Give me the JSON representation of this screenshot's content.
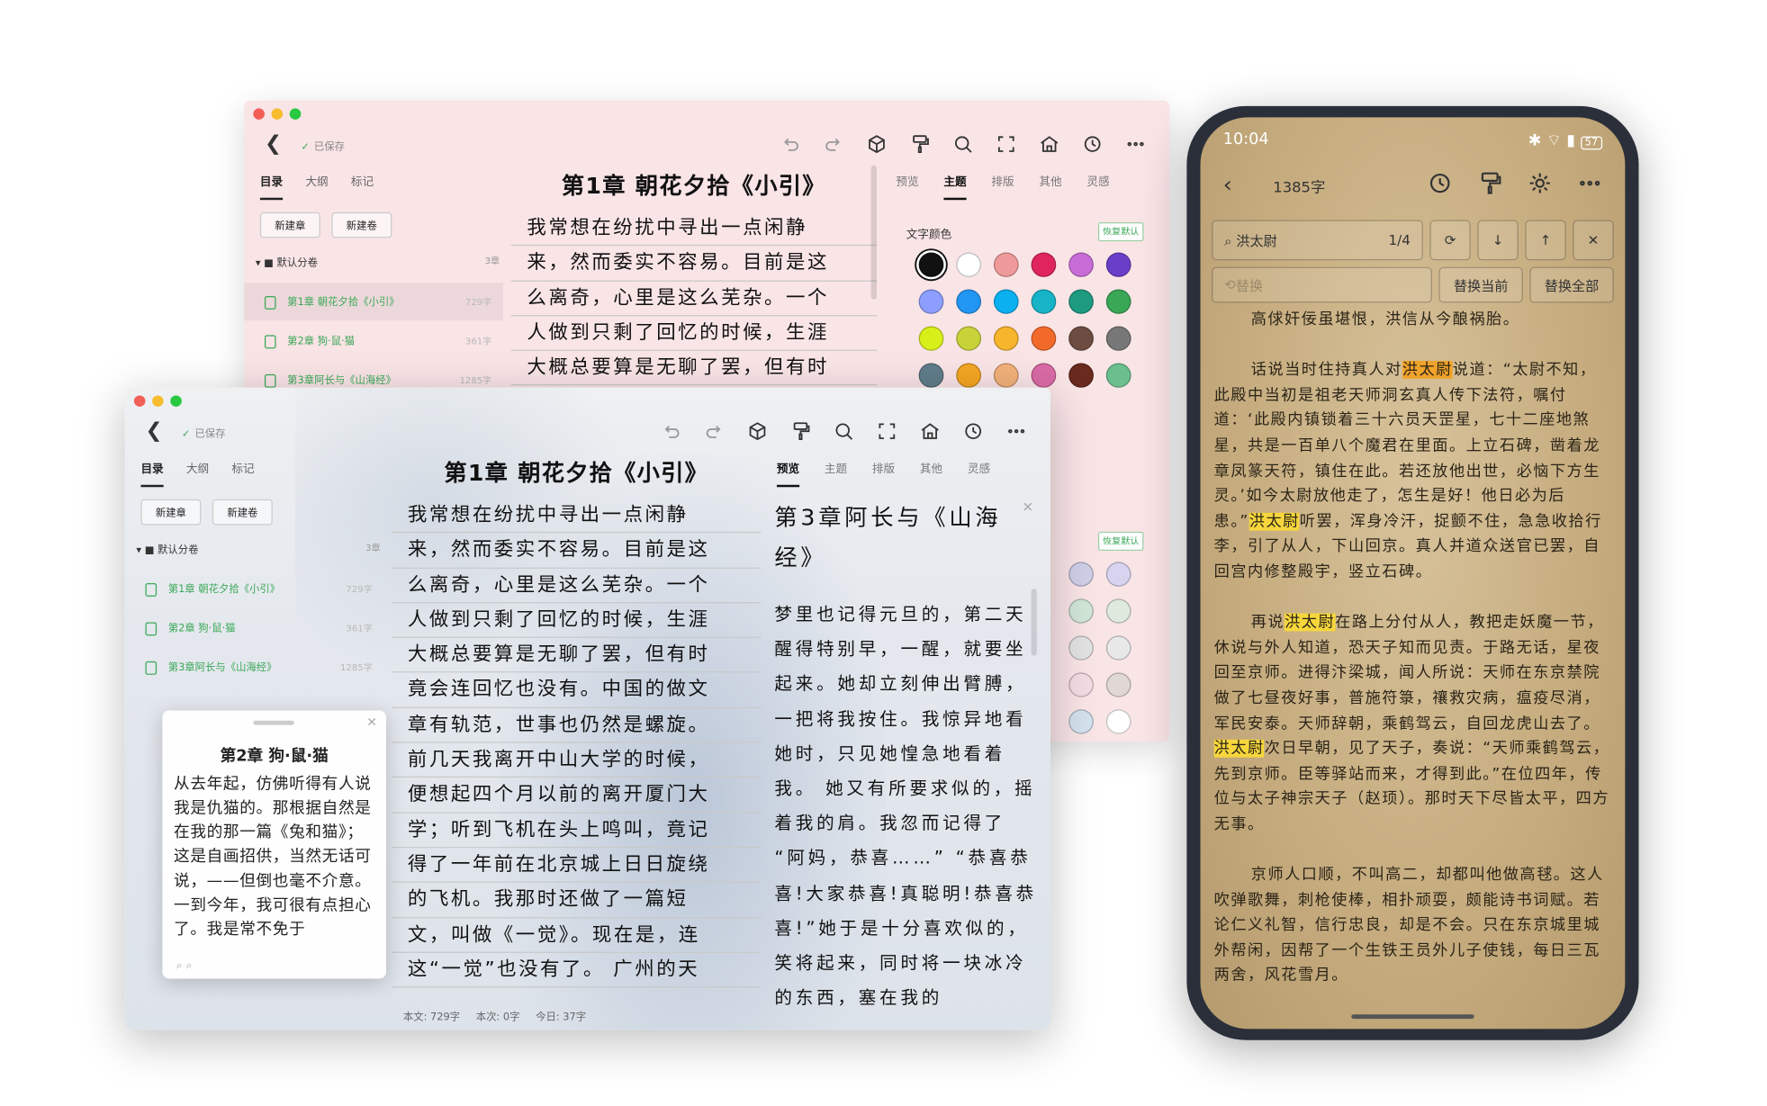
{
  "desktop": {
    "saved": "已保存",
    "left_tabs": [
      "目录",
      "大纲",
      "标记"
    ],
    "new_chapter": "新建章",
    "new_volume": "新建卷",
    "volume": {
      "name": "默认分卷",
      "count": "3章"
    },
    "chapters": [
      {
        "title": "第1章 朝花夕拾《小引》",
        "count": "729字"
      },
      {
        "title": "第2章 狗·鼠·猫",
        "count": "361字"
      },
      {
        "title": "第3章阿长与《山海经》",
        "count": "1285字"
      }
    ],
    "editor_title": "第1章 朝花夕拾《小引》",
    "editor_lines": [
      "我常想在纷扰中寻出一点闲静",
      "来，然而委实不容易。目前是这",
      "么离奇，心里是这么芜杂。一个",
      "人做到只剩了回忆的时候，生涯",
      "大概总要算是无聊了罢，但有时",
      "竟会连回忆也没有。中国的做文",
      "章有轨范，世事也仍然是螺旋。",
      "前几天我离开中山大学的时候，",
      "便想起四个月以前的离开厦门大",
      "学；听到飞机在头上鸣叫，竟记",
      "得了一年前在北京城上日日旋绕",
      "的飞机。我那时还做了一篇短",
      "文，叫做《一觉》。现在是，连",
      "这“一觉”也没有了。 广州的天"
    ],
    "right_tabs": [
      "预览",
      "主题",
      "排版",
      "其他",
      "灵感"
    ],
    "text_color_label": "文字颜色",
    "reset_default": "恢复默认",
    "swatch_colors": [
      "#111111",
      "#ffffff",
      "#ef9a9a",
      "#e0245e",
      "#c86dd7",
      "#6a3fc8",
      "#8c9eff",
      "#2196f3",
      "#0ab0f0",
      "#17b4c8",
      "#1e9a80",
      "#3aa757",
      "#d9ef1a",
      "#c8d33a",
      "#f7b52c",
      "#f26a2a",
      "#6d4c41",
      "#777777",
      "#607d8b",
      "#f5a623",
      "#f3b27a",
      "#d96aa5",
      "#6a2a1e",
      "#6bbf8f"
    ],
    "swatch_colors_2": [
      "#cfcfe8",
      "#d8d4f0",
      "#d2e6d8",
      "#dfe9de",
      "#e2e2e2",
      "#e8e8e8",
      "#f4dce4",
      "#e0d8d4",
      "#d4e2ee",
      "#ffffff"
    ],
    "preview_title": "第3章阿长与《山海经》",
    "preview_body": "梦里也记得元旦的，第二天醒得特别早，一醒，就要坐起来。她却立刻伸出臂膊，一把将我按住。我惊异地看她时，只见她惶急地看着我。 她又有所要求似的，摇着我的肩。我忽而记得了 “阿妈，恭喜……” “恭喜恭喜!大家恭喜!真聪明!恭喜恭喜!”她于是十分喜欢似的，笑将起来，同时将一块冰冷的东西，塞在我的",
    "popup_title": "第2章 狗·鼠·猫",
    "popup_body": "从去年起，仿佛听得有人说我是仇猫的。那根据自然是在我的那一篇《兔和猫》；这是自画招供，当然无话可说，——但倒也毫不介意。一到今年，我可很有点担心了。我是常不免于",
    "status": {
      "body": "本文: 729字",
      "this": "本次: 0字",
      "today": "今日: 37字"
    }
  },
  "phone": {
    "time": "10:04",
    "battery": "57",
    "word_count": "1385字",
    "find_text": "洪太尉",
    "find_pos": "1/4",
    "replace_placeholder": "替换",
    "replace_current": "替换当前",
    "replace_all": "替换全部",
    "paragraphs": [
      [
        {
          "t": "高俅奸佞虽堪恨，洪信从今酿祸胎。"
        }
      ],
      [
        {
          "t": "话说当时住持真人对"
        },
        {
          "t": "洪太尉",
          "h": "cur"
        },
        {
          "t": "说道：“太尉不知，此殿中当初是祖老天师洞玄真人传下法符，嘱付道：‘此殿内镇锁着三十六员天罡星，七十二座地煞星，共是一百单八个魔君在里面。上立石碑，凿着龙章凤篆天符，镇住在此。若还放他出世，必恼下方生灵。’如今太尉放他走了，怎生是好！他日必为后患。”"
        },
        {
          "t": "洪太尉",
          "h": "y"
        },
        {
          "t": "听罢，浑身冷汗，捉颤不住，急急收拾行李，引了从人，下山回京。真人并道众送官已罢，自回宫内修整殿宇，竖立石碑。"
        }
      ],
      [
        {
          "t": "再说"
        },
        {
          "t": "洪太尉",
          "h": "y"
        },
        {
          "t": "在路上分付从人，教把走妖魔一节，休说与外人知道，恐天子知而见责。于路无话，星夜回至京师。进得汴梁城，闻人所说：天师在东京禁院做了七昼夜好事，普施符箓，禳救灾病，瘟疫尽消，军民安泰。天师辞朝，乘鹤驾云，自回龙虎山去了。"
        },
        {
          "t": "洪太尉",
          "h": "y"
        },
        {
          "t": "次日早朝，见了天子，奏说：“天师乘鹤驾云，先到京师。臣等驿站而来，才得到此。”在位四年，传位与太子神宗天子（赵顼）。那时天下尽皆太平，四方无事。"
        }
      ],
      [
        {
          "t": "京师人口顺，不叫高二，却都叫他做高毬。这人吹弹歌舞，刺枪使棒，相扑顽耍，颇能诗书词赋。若论仁义礼智，信行忠良，却是不会。只在东京城里城外帮闲，因帮了一个生铁王员外儿子使钱，每日三瓦两舍，风花雪月。"
        }
      ]
    ]
  }
}
